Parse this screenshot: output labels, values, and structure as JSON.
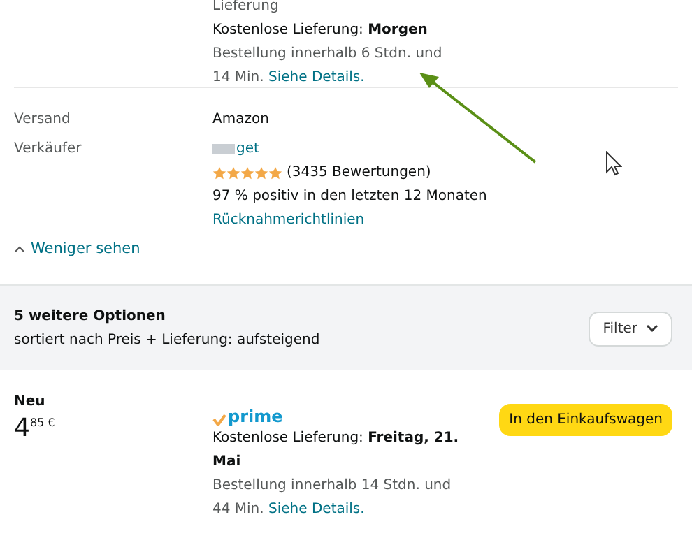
{
  "delivery": {
    "top_line": "Lieferung",
    "free_label": "Kostenlose Lieferung: ",
    "free_date": "Morgen",
    "order_text": "Bestellung innerhalb 6 Stdn. und 14 Min.",
    "details_link": "Siehe Details."
  },
  "details": [
    {
      "kind": "text",
      "label": "Versand",
      "value": "Amazon"
    },
    {
      "kind": "seller",
      "label": "Verkäufer",
      "name": "get",
      "stars": 5,
      "ratings": "(3435 Bewertungen)",
      "positive": "97 % positiv in den letzten 12 Monaten",
      "returns_link": "Rücknahmerichtlinien"
    }
  ],
  "less_link": "Weniger sehen",
  "options": {
    "title": "5 weitere Optionen",
    "sort": "sortiert nach Preis + Lieferung: aufsteigend",
    "filter": "Filter"
  },
  "offer": {
    "condition": "Neu",
    "price_whole": "4",
    "price_fraction": "85",
    "currency": "€",
    "prime": "prime",
    "free_label": "Kostenlose Lieferung: ",
    "free_date": "Freitag, 21. Mai",
    "order_text": "Bestellung innerhalb 14 Stdn. und 44 Min.",
    "details_link": "Siehe Details.",
    "cart_button": "In den Einkaufswagen"
  }
}
